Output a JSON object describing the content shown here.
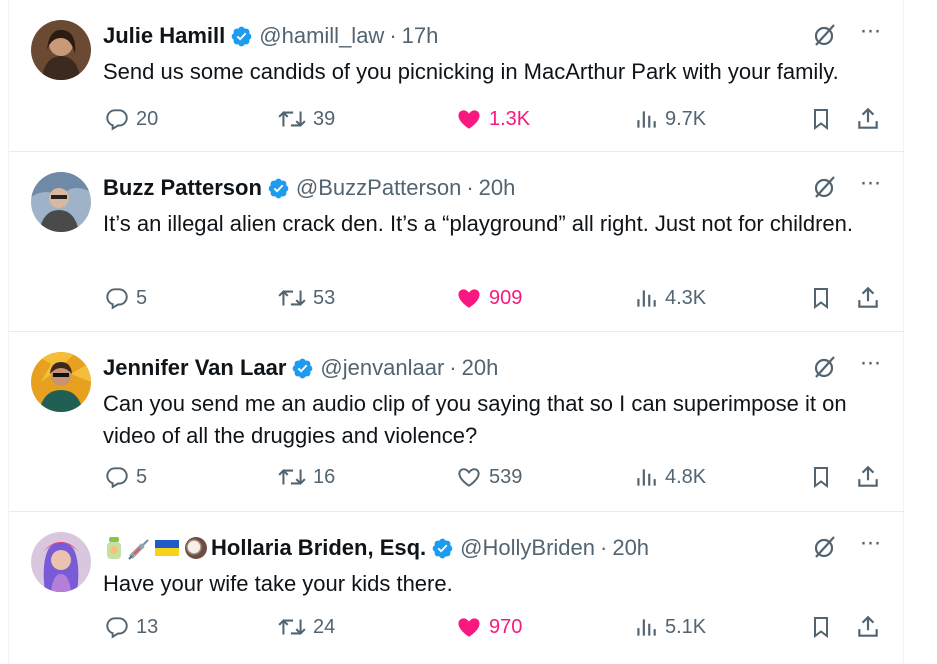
{
  "tweets": [
    {
      "name": "Julie Hamill",
      "handle": "@hamill_law",
      "separator": "·",
      "time": "17h",
      "text": "Send us some candids of you picnicking in MacArthur Park with your family.",
      "replies": "20",
      "retweets": "39",
      "likes": "1.3K",
      "liked": true,
      "views": "9.7K"
    },
    {
      "name": "Buzz Patterson",
      "handle": "@BuzzPatterson",
      "separator": "·",
      "time": "20h",
      "text": "It’s an illegal alien crack den. It’s a “playground” all right. Just not for children.",
      "replies": "5",
      "retweets": "53",
      "likes": "909",
      "liked": true,
      "views": "4.3K"
    },
    {
      "name": "Jennifer Van Laar",
      "handle": "@jenvanlaar",
      "separator": "·",
      "time": "20h",
      "text": "Can you send me an audio clip of you saying that so I can superimpose it on video of all the druggies and violence?",
      "replies": "5",
      "retweets": "16",
      "likes": "539",
      "liked": false,
      "views": "4.8K"
    },
    {
      "name": "Hollaria Briden, Esq.",
      "name_emojis": [
        "bottle-feeding-baby-emoji",
        "syringe-emoji",
        "ukraine-flag-emoji",
        "coconut-emoji"
      ],
      "handle": "@HollyBriden",
      "separator": "·",
      "time": "20h",
      "text": "Have your wife take your kids there.",
      "replies": "13",
      "retweets": "24",
      "likes": "970",
      "liked": true,
      "views": "5.1K"
    }
  ],
  "colors": {
    "muted": "#536471",
    "like": "#f91880",
    "verified": "#1d9bf0"
  }
}
